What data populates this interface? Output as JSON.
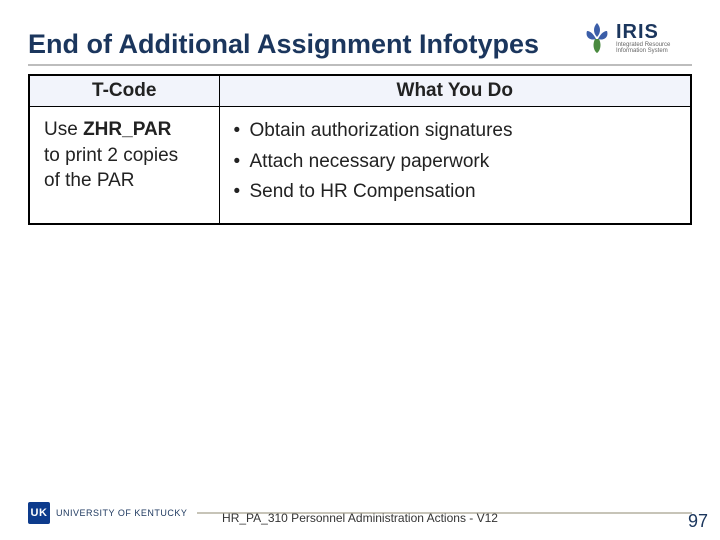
{
  "header": {
    "title": "End of Additional Assignment Infotypes",
    "logo": {
      "main": "IRIS",
      "sub1": "Integrated Resource",
      "sub2": "Information System"
    }
  },
  "table": {
    "headers": {
      "tcode": "T-Code",
      "whatyoudo": "What You Do"
    },
    "row": {
      "tcode_line1_prefix": "Use ",
      "tcode_line1_bold": "ZHR_PAR",
      "tcode_line2": "to print 2 copies",
      "tcode_line3": "of the PAR",
      "actions": [
        "Obtain authorization signatures",
        "Attach necessary paperwork",
        "Send to HR Compensation"
      ]
    }
  },
  "footer": {
    "uk_badge": "UK",
    "uk_text": "UNIVERSITY OF KENTUCKY",
    "caption": "HR_PA_310 Personnel Administration Actions - V12",
    "page": "97"
  }
}
